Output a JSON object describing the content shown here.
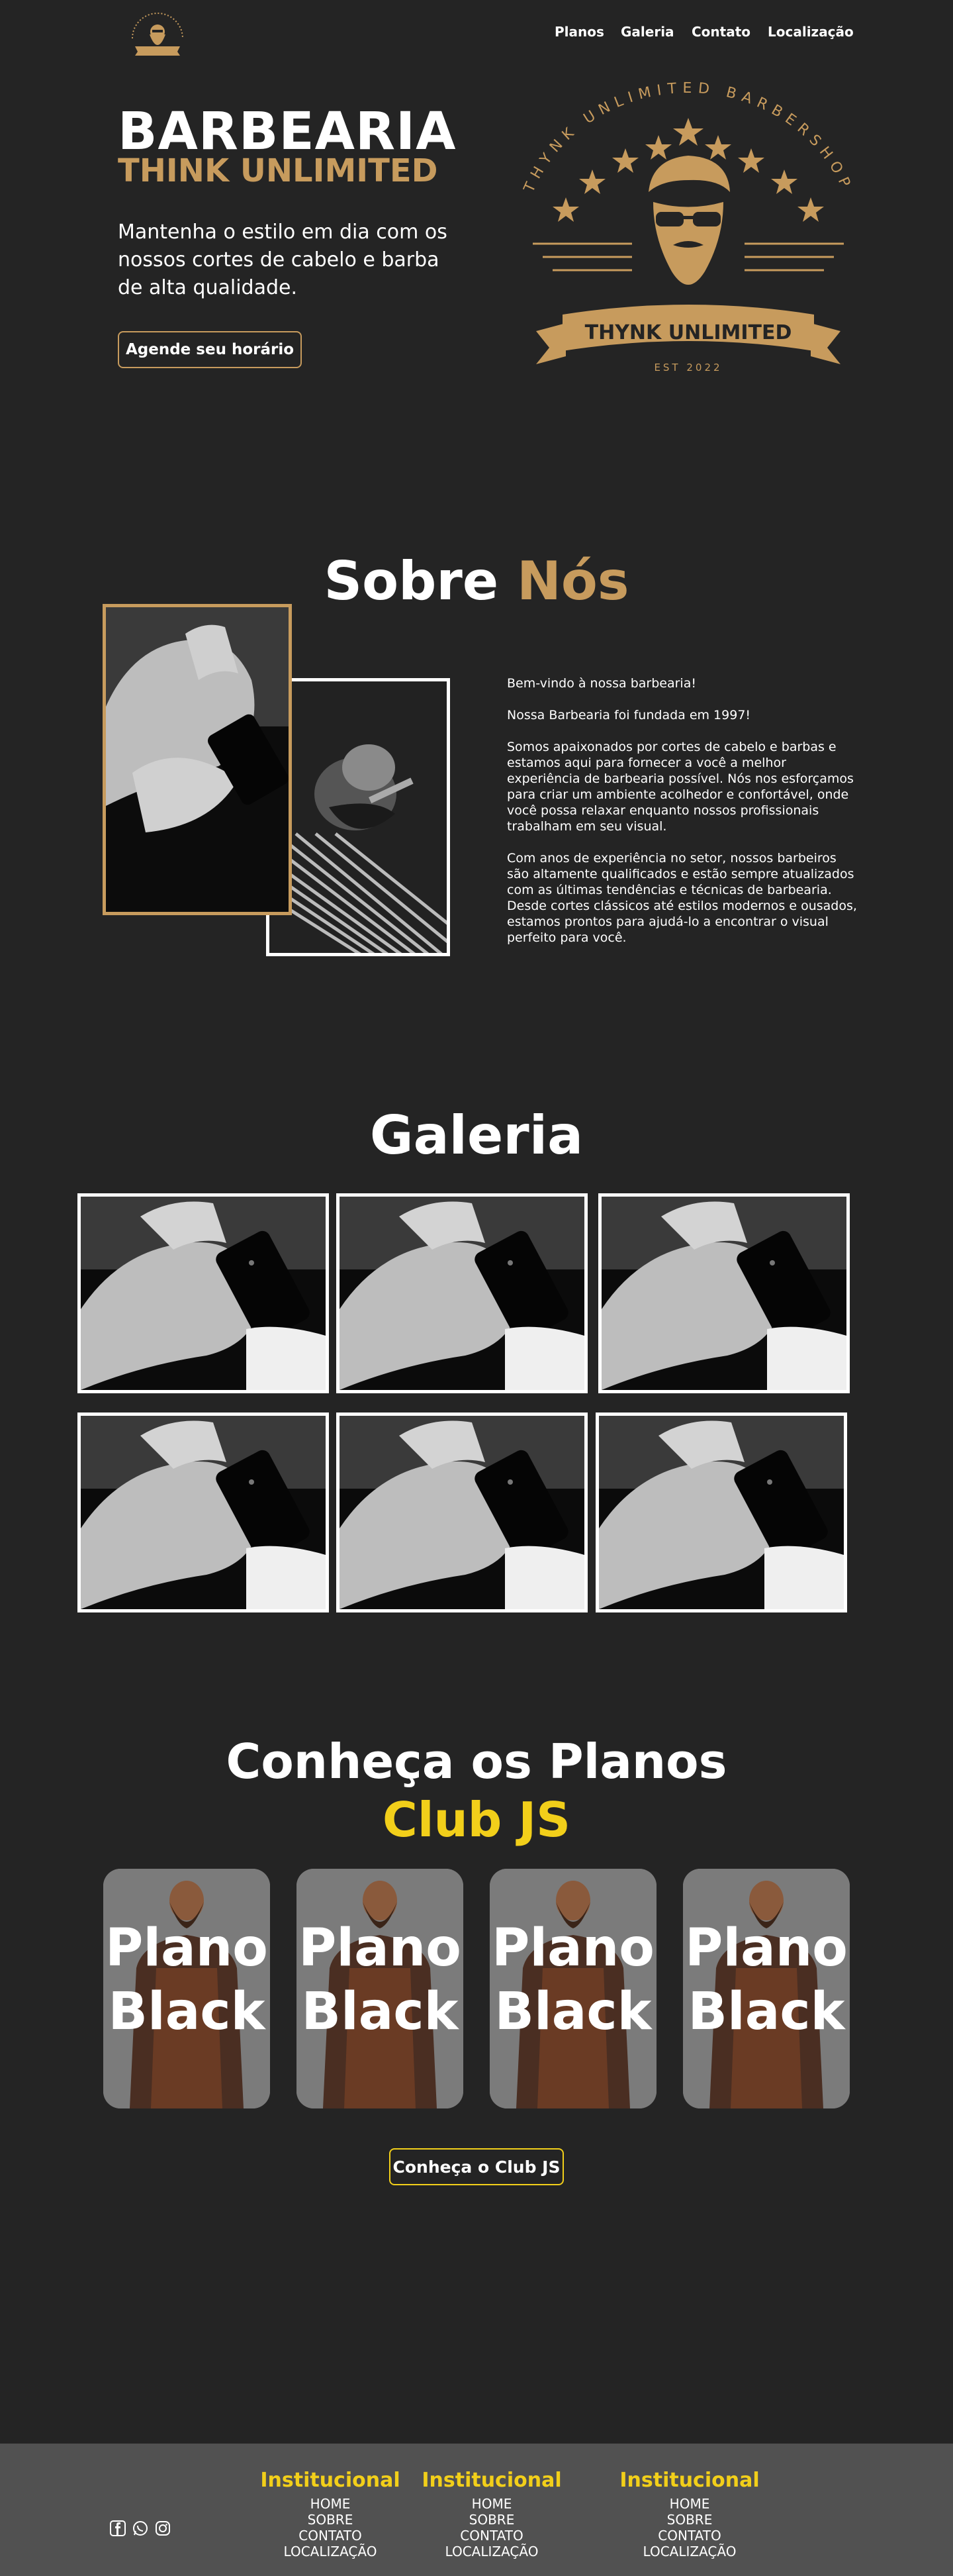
{
  "nav": {
    "items": [
      "Planos",
      "Galeria",
      "Contato",
      "Localização"
    ]
  },
  "hero": {
    "title": "BARBEARIA",
    "subtitle": "THINK UNLIMITED",
    "text": "Mantenha o estilo em dia com os nossos cortes de cabelo e barba de alta qualidade.",
    "cta": "Agende seu horário",
    "logo": {
      "arc_text": "THYNK UNLIMITED BARBERSHOP",
      "banner_text": "THYNK UNLIMITED",
      "est": "EST 2022"
    }
  },
  "about": {
    "title_a": "Sobre",
    "title_b": "Nós",
    "paragraphs": [
      "Bem-vindo à nossa barbearia!",
      "Nossa Barbearia foi fundada em 1997!",
      "Somos apaixonados por cortes de cabelo e barbas e estamos aqui para fornecer a você a melhor experiência de barbearia possível. Nós nos esforçamos para criar um ambiente acolhedor e confortável, onde você possa relaxar enquanto nossos profissionais trabalham em seu visual.",
      "Com anos de experiência no setor, nossos barbeiros são altamente qualificados e estão sempre atualizados com as últimas tendências e técnicas de barbearia. Desde cortes clássicos até estilos modernos e ousados, estamos prontos para ajudá-lo a encontrar o visual perfeito para você."
    ]
  },
  "gallery": {
    "title": "Galeria"
  },
  "plans": {
    "title_a": "Conheça os Planos",
    "title_b": "Club JS",
    "cards": [
      {
        "label": "Plano Black"
      },
      {
        "label": "Plano Black"
      },
      {
        "label": "Plano Black"
      },
      {
        "label": "Plano Black"
      }
    ],
    "cta": "Conheça o Club JS"
  },
  "footer": {
    "columns": [
      {
        "title": "Institucional",
        "links": [
          "HOME",
          "SOBRE",
          "CONTATO",
          "LOCALIZAÇÃO"
        ]
      },
      {
        "title": "Institucional",
        "links": [
          "HOME",
          "SOBRE",
          "CONTATO",
          "LOCALIZAÇÃO"
        ]
      },
      {
        "title": "Institucional",
        "links": [
          "HOME",
          "SOBRE",
          "CONTATO",
          "LOCALIZAÇÃO"
        ]
      }
    ],
    "social_icons": [
      "facebook-icon",
      "whatsapp-icon",
      "instagram-icon"
    ]
  },
  "colors": {
    "background": "#242424",
    "gold": "#c79b5d",
    "yellow": "#f2cf1a",
    "footer": "#515151"
  }
}
